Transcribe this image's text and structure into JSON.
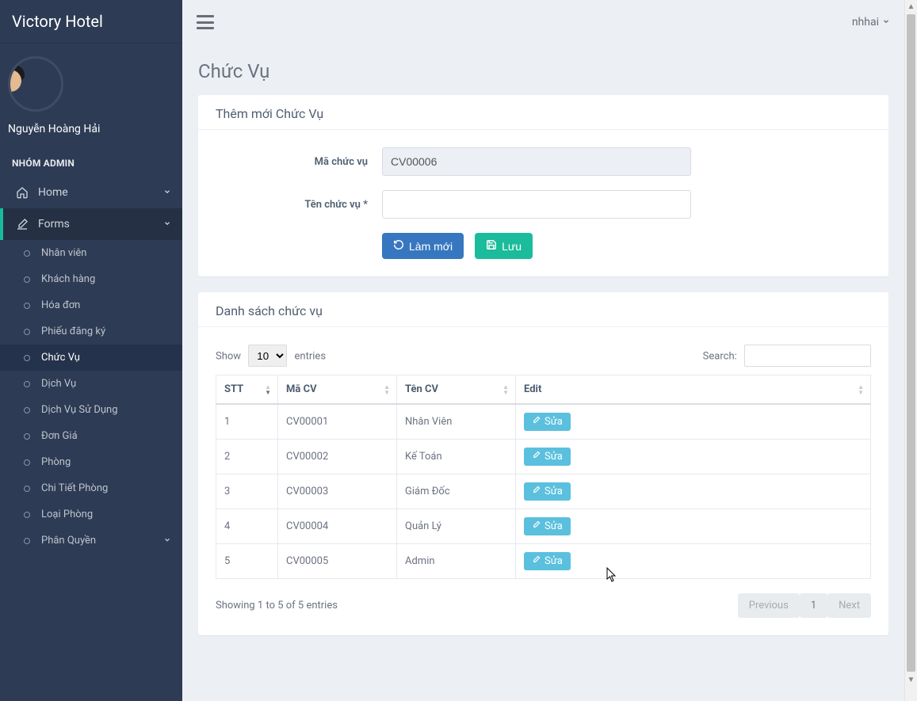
{
  "brand": "Victory Hotel",
  "user": {
    "displayName": "Nguyễn Hoàng Hải",
    "shortName": "nhhai"
  },
  "sidebar": {
    "groupHeader": "NHÓM ADMIN",
    "nav": [
      {
        "label": "Home",
        "icon": "home-icon",
        "hasChildren": true,
        "expanded": false
      },
      {
        "label": "Forms",
        "icon": "edit-icon",
        "hasChildren": true,
        "expanded": true
      }
    ],
    "sub": [
      {
        "label": "Nhân viên"
      },
      {
        "label": "Khách hàng"
      },
      {
        "label": "Hóa đơn"
      },
      {
        "label": "Phiếu đăng ký"
      },
      {
        "label": "Chức Vụ",
        "active": true
      },
      {
        "label": "Dịch Vụ"
      },
      {
        "label": "Dịch Vụ Sử Dụng"
      },
      {
        "label": "Đơn Giá"
      },
      {
        "label": "Phòng"
      },
      {
        "label": "Chi Tiết Phòng"
      },
      {
        "label": "Loại Phòng"
      },
      {
        "label": "Phân Quyền",
        "hasChildren": true
      }
    ]
  },
  "page": {
    "title": "Chức Vụ",
    "form": {
      "header": "Thêm mới Chức Vụ",
      "codeLabel": "Mã chức vụ",
      "codeValue": "CV00006",
      "nameLabel": "Tên chức vụ *",
      "nameValue": "",
      "resetLabel": "Làm mới",
      "saveLabel": "Lưu"
    },
    "list": {
      "header": "Danh sách chức vụ",
      "showLabel": "Show",
      "entriesLabel": "entries",
      "pageSize": "10",
      "searchLabel": "Search:",
      "searchValue": "",
      "columns": [
        "STT",
        "Mã CV",
        "Tên CV",
        "Edit"
      ],
      "editBtnLabel": "Sửa",
      "rows": [
        {
          "stt": "1",
          "ma": "CV00001",
          "ten": "Nhân Viên"
        },
        {
          "stt": "2",
          "ma": "CV00002",
          "ten": "Kế Toán"
        },
        {
          "stt": "3",
          "ma": "CV00003",
          "ten": "Giám Đốc"
        },
        {
          "stt": "4",
          "ma": "CV00004",
          "ten": "Quản Lý"
        },
        {
          "stt": "5",
          "ma": "CV00005",
          "ten": "Admin"
        }
      ],
      "info": "Showing 1 to 5 of 5 entries",
      "prevLabel": "Previous",
      "currentPage": "1",
      "nextLabel": "Next"
    }
  }
}
